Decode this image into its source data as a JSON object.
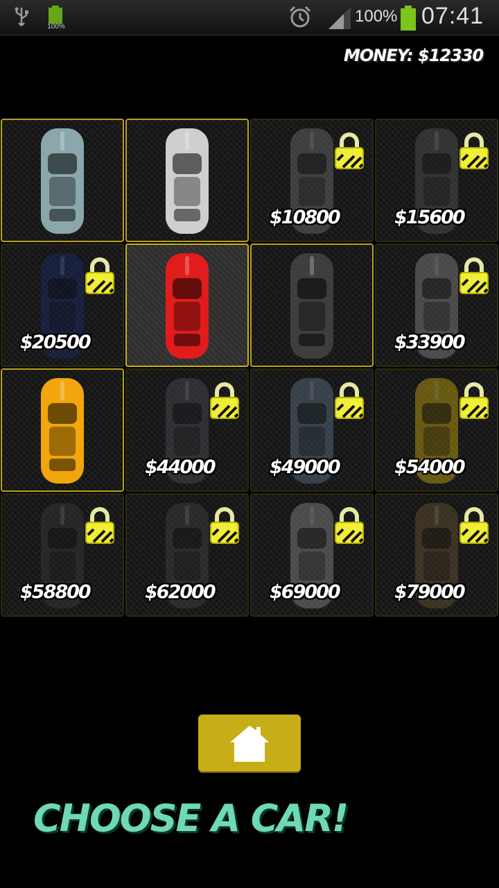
{
  "status_bar": {
    "battery_small_label": "100%",
    "battery_percent": "100%",
    "time": "07:41"
  },
  "money_label": "MONEY: $12330",
  "cars": [
    {
      "color": "#8ba7ac",
      "price": "",
      "locked": false,
      "selected": false
    },
    {
      "color": "#cfcfcf",
      "price": "",
      "locked": false,
      "selected": false
    },
    {
      "color": "#6f6f6f",
      "price": "$10800",
      "locked": true,
      "selected": false
    },
    {
      "color": "#555555",
      "price": "$15600",
      "locked": true,
      "selected": false
    },
    {
      "color": "#1b2c6e",
      "price": "$20500",
      "locked": true,
      "selected": false
    },
    {
      "color": "#e01c1c",
      "price": "",
      "locked": false,
      "selected": true
    },
    {
      "color": "#3c3f3c",
      "price": "",
      "locked": false,
      "selected": false
    },
    {
      "color": "#8a8a8a",
      "price": "$33900",
      "locked": true,
      "selected": false
    },
    {
      "color": "#f2a60d",
      "price": "",
      "locked": false,
      "selected": false
    },
    {
      "color": "#4a4f55",
      "price": "$44000",
      "locked": true,
      "selected": false
    },
    {
      "color": "#5f7588",
      "price": "$49000",
      "locked": true,
      "selected": false
    },
    {
      "color": "#c9a90f",
      "price": "$54000",
      "locked": true,
      "selected": false
    },
    {
      "color": "#3a3a3a",
      "price": "$58800",
      "locked": true,
      "selected": false
    },
    {
      "color": "#444444",
      "price": "$62000",
      "locked": true,
      "selected": false
    },
    {
      "color": "#8c8c8c",
      "price": "$69000",
      "locked": true,
      "selected": false
    },
    {
      "color": "#6a5636",
      "price": "$79000",
      "locked": true,
      "selected": false
    }
  ],
  "home_button": {
    "icon": "home-icon"
  },
  "heading": "CHOOSE A CAR!"
}
